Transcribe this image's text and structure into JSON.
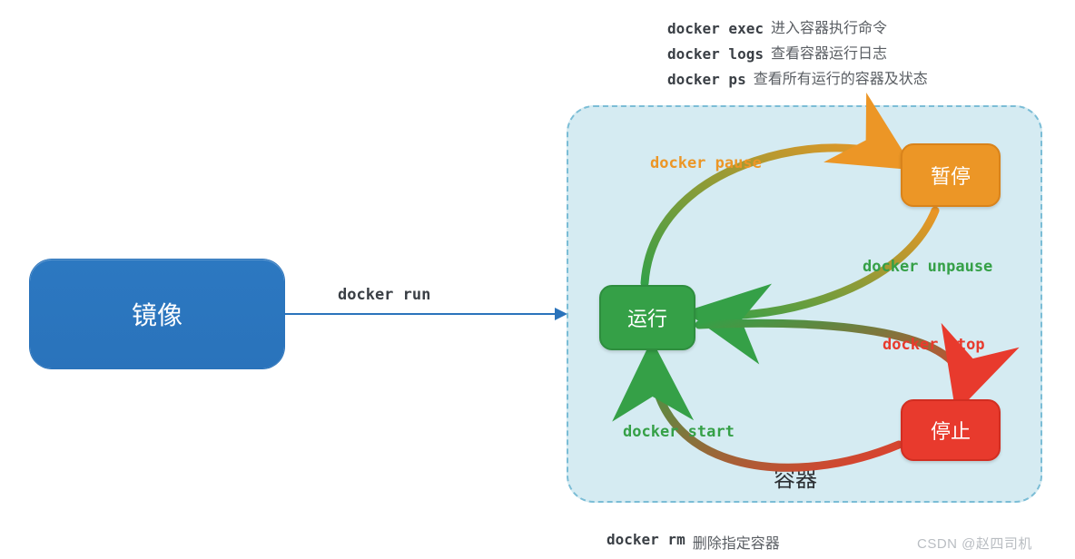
{
  "commands": {
    "exec": {
      "cmd": "docker exec",
      "desc": "进入容器执行命令"
    },
    "logs": {
      "cmd": "docker logs",
      "desc": "查看容器运行日志"
    },
    "ps": {
      "cmd": "docker ps",
      "desc": "查看所有运行的容器及状态"
    },
    "run": {
      "cmd": "docker run"
    },
    "rm": {
      "cmd": "docker rm",
      "desc": "删除指定容器"
    }
  },
  "nodes": {
    "image": "镜像",
    "running": "运行",
    "paused": "暂停",
    "stopped": "停止",
    "container": "容器"
  },
  "edges": {
    "pause": "docker pause",
    "unpause": "docker unpause",
    "stop": "docker stop",
    "start": "docker start"
  },
  "watermark": "CSDN @赵四司机",
  "colors": {
    "blue": "#2a73bb",
    "green": "#35a047",
    "orange": "#ec9626",
    "red": "#e83a2d",
    "panel": "#d5ebf2"
  }
}
